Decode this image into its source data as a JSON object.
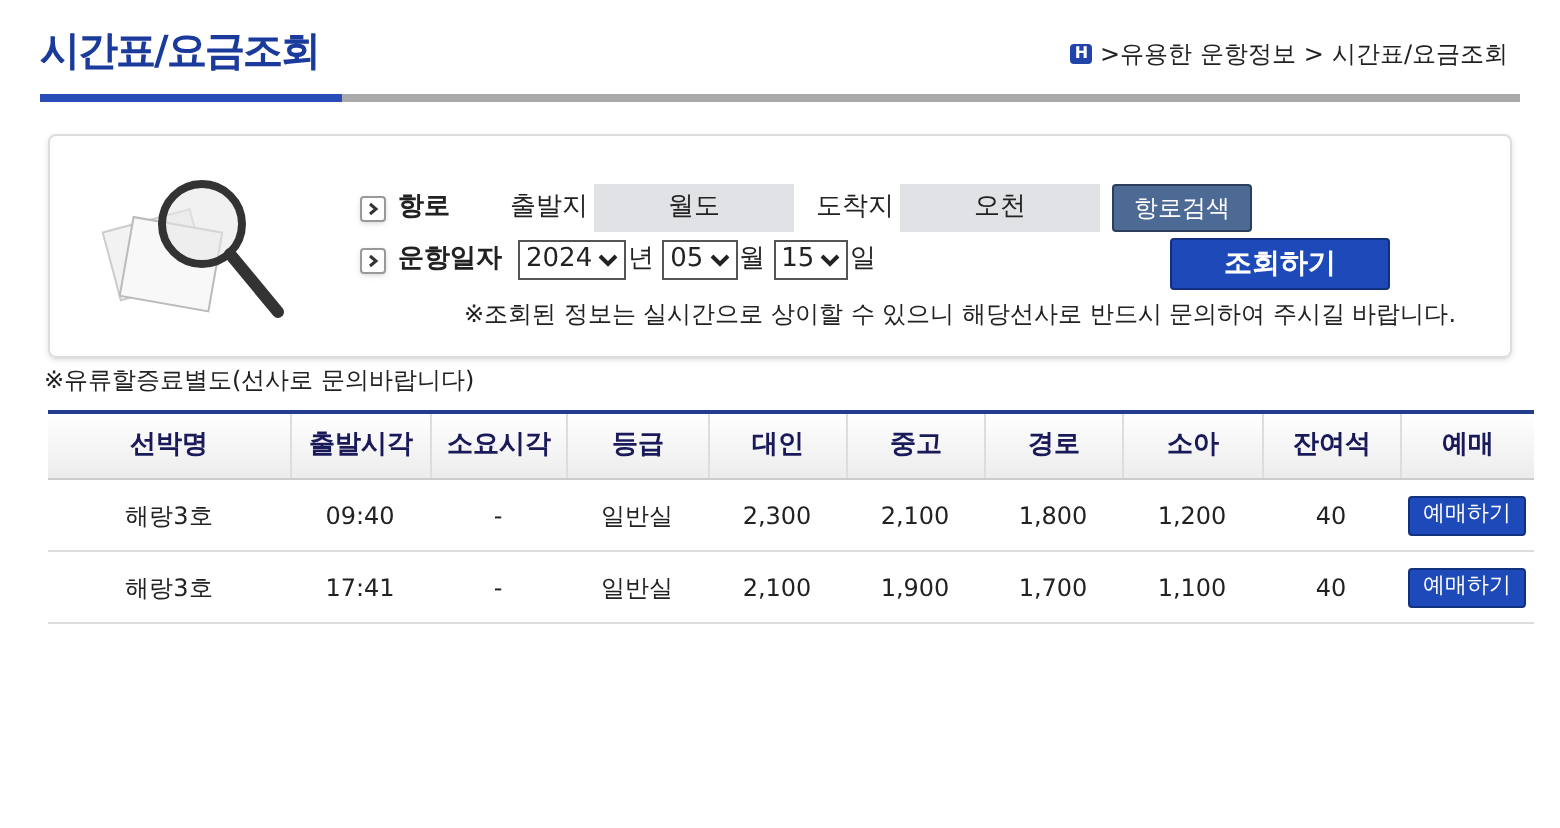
{
  "page_title": "시간표/요금조회",
  "breadcrumb": {
    "home_badge": "H",
    "items": [
      ">유용한 운항정보",
      ">",
      "시간표/요금조회"
    ]
  },
  "search": {
    "route_label": "항로",
    "departure_label": "출발지",
    "departure_value": "월도",
    "arrival_label": "도착지",
    "arrival_value": "오천",
    "route_search_button": "항로검색",
    "date_label": "운항일자",
    "year": "2024",
    "year_unit": "년",
    "month": "05",
    "month_unit": "월",
    "day": "15",
    "day_unit": "일",
    "submit_button": "조회하기",
    "notice": "※조회된 정보는 실시간으로 상이할 수 있으니 해당선사로 반드시 문의하여 주시길 바랍니다."
  },
  "fuel_note": "※유류할증료별도(선사로 문의바랍니다)",
  "table": {
    "columns": [
      "선박명",
      "출발시각",
      "소요시각",
      "등급",
      "대인",
      "중고",
      "경로",
      "소아",
      "잔여석",
      "예매"
    ],
    "rows": [
      {
        "cells": [
          "해랑3호",
          "09:40",
          "-",
          "일반실",
          "2,300",
          "2,100",
          "1,800",
          "1,200",
          "40"
        ],
        "button": "예매하기"
      },
      {
        "cells": [
          "해랑3호",
          "17:41",
          "-",
          "일반실",
          "2,100",
          "1,900",
          "1,700",
          "1,100",
          "40"
        ],
        "button": "예매하기"
      }
    ]
  }
}
